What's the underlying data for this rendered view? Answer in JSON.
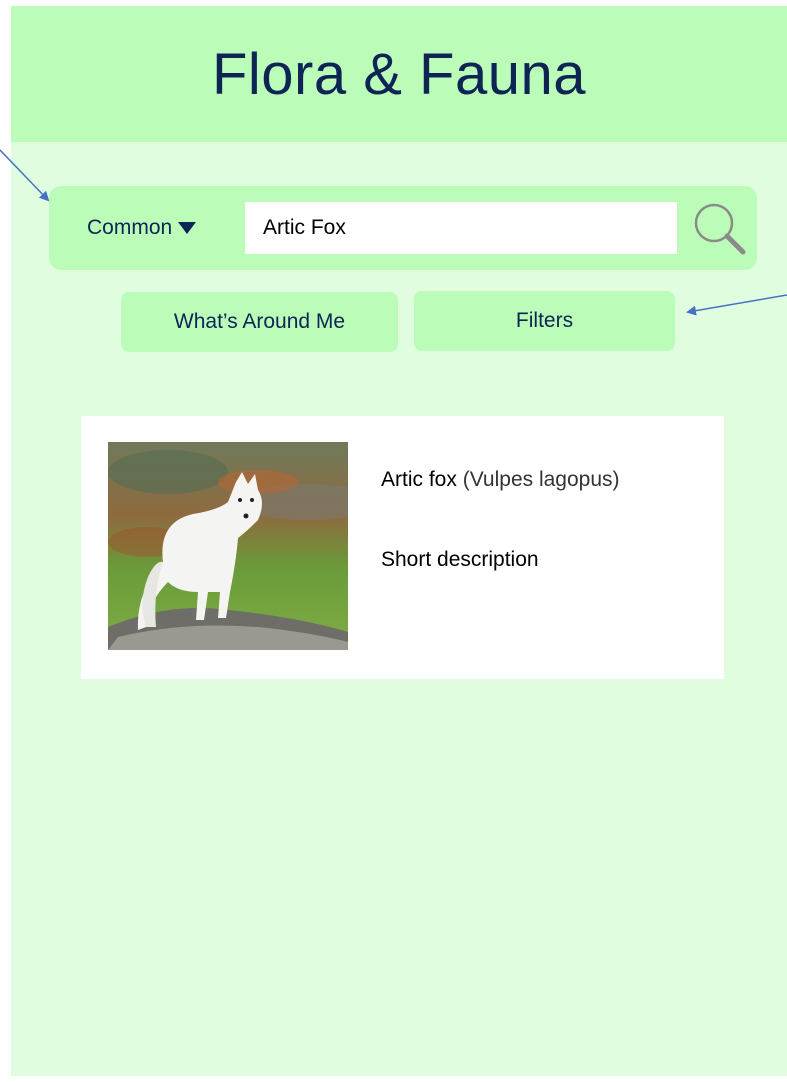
{
  "header": {
    "title": "Flora & Fauna"
  },
  "search": {
    "mode_label": "Common",
    "query": "Artic Fox"
  },
  "actions": {
    "around_me_label": "What’s Around Me",
    "filters_label": "Filters"
  },
  "result": {
    "common_name": "Artic fox",
    "scientific_name": "(Vulpes lagopus)",
    "description": "Short description"
  },
  "colors": {
    "background": "#e1fde0",
    "header": "#bbfdb8",
    "button": "#bbfdb8",
    "text_accent": "#0e2455",
    "annotation_arrow": "#4472c4"
  },
  "icons": [
    "search-icon",
    "dropdown-triangle-icon",
    "fox-photo"
  ]
}
